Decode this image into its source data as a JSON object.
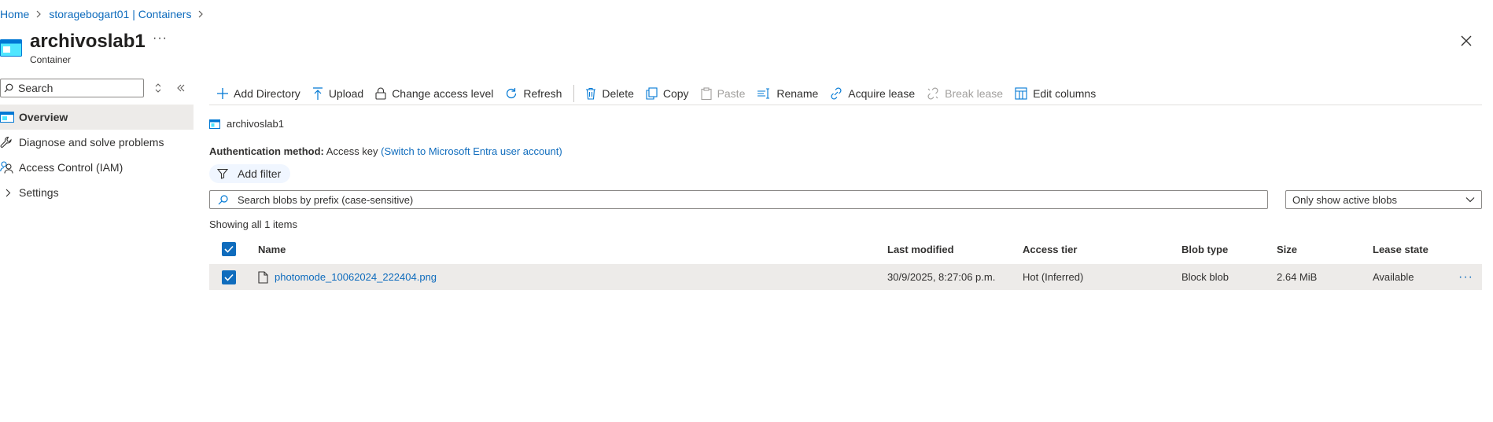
{
  "breadcrumb": {
    "items": [
      {
        "label": "Home"
      },
      {
        "label": "storagebogart01 | Containers"
      }
    ]
  },
  "header": {
    "title": "archivoslab1",
    "more": "···",
    "subtitle": "Container",
    "icon": "container-icon"
  },
  "sidebar": {
    "search_placeholder": "Search",
    "items": [
      {
        "label": "Overview",
        "icon": "overview-icon",
        "active": true
      },
      {
        "label": "Diagnose and solve problems",
        "icon": "wrench-icon"
      },
      {
        "label": "Access Control (IAM)",
        "icon": "people-icon"
      },
      {
        "label": "Settings",
        "icon": "chevron-right-icon"
      }
    ]
  },
  "toolbar": {
    "add_directory": "Add Directory",
    "upload": "Upload",
    "change_access": "Change access level",
    "refresh": "Refresh",
    "delete": "Delete",
    "copy": "Copy",
    "paste": "Paste",
    "rename": "Rename",
    "acquire_lease": "Acquire lease",
    "break_lease": "Break lease",
    "edit_columns": "Edit columns"
  },
  "container_path": "archivoslab1",
  "auth": {
    "label": "Authentication method:",
    "value": "Access key",
    "switch_link": "(Switch to Microsoft Entra user account)"
  },
  "filter": {
    "label": "Add filter"
  },
  "blob_search": {
    "placeholder": "Search blobs by prefix (case-sensitive)"
  },
  "blob_filter_dropdown": {
    "selected": "Only show active blobs"
  },
  "showing_text": "Showing all 1 items",
  "table": {
    "columns": [
      "Name",
      "Last modified",
      "Access tier",
      "Blob type",
      "Size",
      "Lease state"
    ],
    "rows": [
      {
        "name": "photomode_10062024_222404.png",
        "last_modified": "30/9/2025, 8:27:06 p.m.",
        "access_tier": "Hot (Inferred)",
        "blob_type": "Block blob",
        "size": "2.64 MiB",
        "lease_state": "Available",
        "selected": true
      }
    ]
  },
  "colors": {
    "accent": "#0f6cbd",
    "selected_row": "#edebe9",
    "text": "#323130"
  }
}
